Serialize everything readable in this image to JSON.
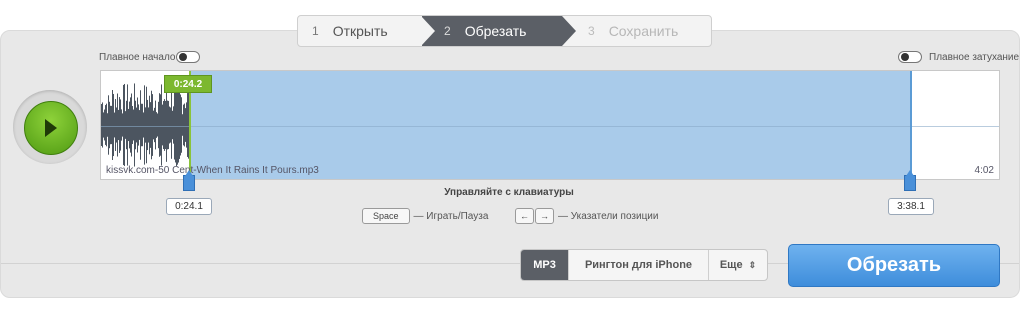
{
  "steps": [
    {
      "num": "1",
      "label": "Открыть"
    },
    {
      "num": "2",
      "label": "Обрезать"
    },
    {
      "num": "3",
      "label": "Сохранить"
    }
  ],
  "fade_in_label": "Плавное начало",
  "fade_out_label": "Плавное затухание",
  "play_position": "0:24.2",
  "file_name": "kissvk.com-50 Cent-When It Rains It Pours.mp3",
  "duration": "4:02",
  "start_time": "0:24.1",
  "end_time": "3:38.1",
  "keyboard": {
    "title": "Управляйте с клавиатуры",
    "space_key": "Space",
    "space_desc": "— Играть/Пауза",
    "left_key": "←",
    "right_key": "→",
    "arrows_desc": "— Указатели позиции"
  },
  "formats": {
    "mp3": "MP3",
    "iphone": "Рингтон для iPhone",
    "more": "Еще"
  },
  "cut_button": "Обрезать",
  "colors": {
    "selection": "#a9cbea",
    "play_green": "#7cb82f",
    "handle_blue": "#4a90d9",
    "cut_button": "#3e8ddb"
  }
}
